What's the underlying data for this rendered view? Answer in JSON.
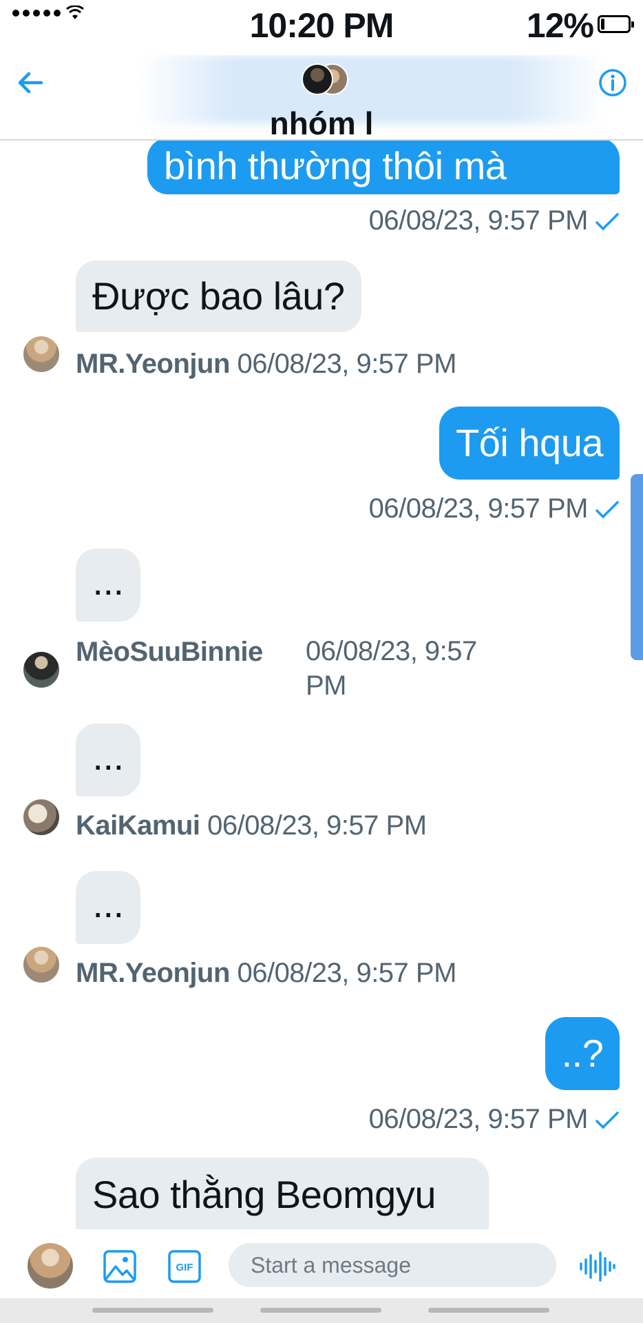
{
  "status_bar": {
    "time": "10:20 PM",
    "battery_percent": "12%",
    "battery_level": 0.12
  },
  "header": {
    "title": "nhóm l"
  },
  "messages": [
    {
      "direction": "outgoing",
      "text": "bình thường thôi mà",
      "meta": "06/08/23, 9:57 PM",
      "read": true
    },
    {
      "direction": "incoming",
      "text": "Được bao lâu?",
      "sender": "MR.Yeonjun",
      "meta": "06/08/23, 9:57 PM"
    },
    {
      "direction": "outgoing",
      "text": "Tối hqua",
      "meta": "06/08/23, 9:57 PM",
      "read": true
    },
    {
      "direction": "incoming",
      "text": "...",
      "sender": "MèoSuuBinnie",
      "meta_line1": "06/08/23, 9:57",
      "meta_line2": "PM"
    },
    {
      "direction": "incoming",
      "text": "...",
      "sender": "KaiKamui",
      "meta": "06/08/23, 9:57 PM"
    },
    {
      "direction": "incoming",
      "text": "...",
      "sender": "MR.Yeonjun",
      "meta": "06/08/23, 9:57 PM"
    },
    {
      "direction": "outgoing",
      "text": "..?",
      "meta": "06/08/23, 9:57 PM",
      "read": true
    },
    {
      "direction": "incoming",
      "text": "Sao thằng Beomgyu"
    }
  ],
  "composer": {
    "placeholder": "Start a message"
  },
  "colors": {
    "accent": "#1d9bf0",
    "incoming_bubble": "#e7ecf0",
    "meta_text": "#536471"
  },
  "icons": [
    "back-arrow-icon",
    "info-icon",
    "check-icon",
    "image-icon",
    "gif-icon",
    "voice-wave-icon"
  ]
}
